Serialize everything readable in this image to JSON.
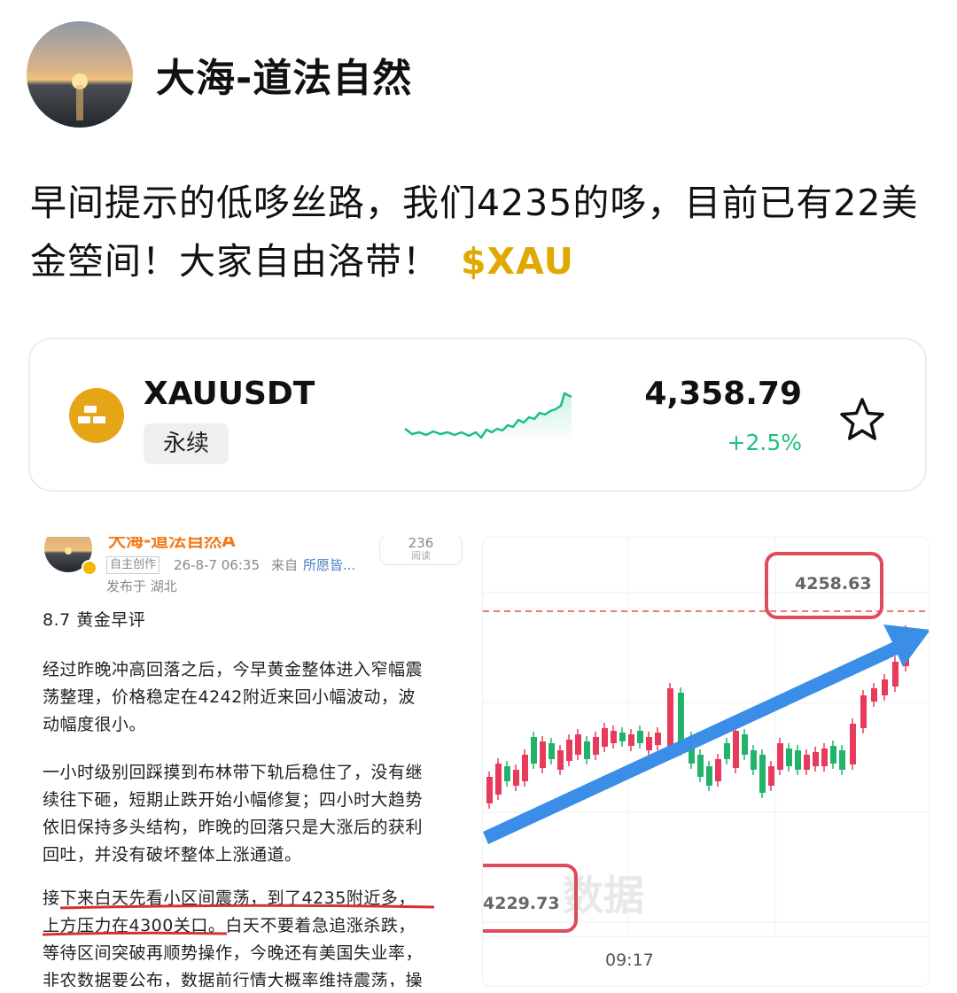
{
  "author": {
    "name": "大海-道法自然"
  },
  "post": {
    "text": "早间提示的低哆丝路，我们4235的哆，目前已有22美金箜间！大家自由洛带！",
    "tag": "$XAU"
  },
  "ticker": {
    "symbol": "XAUUSDT",
    "badge": "永续",
    "price": "4,358.79",
    "change": "+2.5%",
    "colors": {
      "up": "#1fbf7f",
      "coin": "#e6a417",
      "tag": "#e0a800"
    }
  },
  "left_image": {
    "name": "大海-道法自然A",
    "reads": "236",
    "reads_label": "阅读",
    "source_badge": "自主创作",
    "time": "26-8-7 06:35",
    "from": "来自",
    "device": "所愿皆...",
    "location": "发布于 湖北",
    "title": "8.7 黄金早评",
    "para1_l1": "经过昨晚冲高回落之后，今早黄金整体进入窄幅震",
    "para1_l2": "荡整理，价格稳定在4242附近来回小幅波动，波",
    "para1_l3": "动幅度很小。",
    "para2_l1": "一小时级别回踩摸到布林带下轨后稳住了，没有继",
    "para2_l2": "续往下砸，短期止跌开始小幅修复；四小时大趋势",
    "para2_l3": "依旧保持多头结构，昨晚的回落只是大涨后的获利",
    "para2_l4": "回吐，并没有破坏整体上涨通道。",
    "para3_l1": "接下来白天先看小区间震荡，到了4235附近多，",
    "para3_l2a": "上方压力在4300关口。",
    "para3_l2b": "白天不要着急追涨杀跌，",
    "para3_l3": "等待区间突破再顺势操作，今晚还有美国失业率，",
    "para3_l4": "非农数据要公布，数据前行情大概率维持震荡，操"
  },
  "right_image": {
    "high_label": "4258.63",
    "low_label": "4229.73",
    "time_label": "09:17",
    "watermark": "数据"
  }
}
